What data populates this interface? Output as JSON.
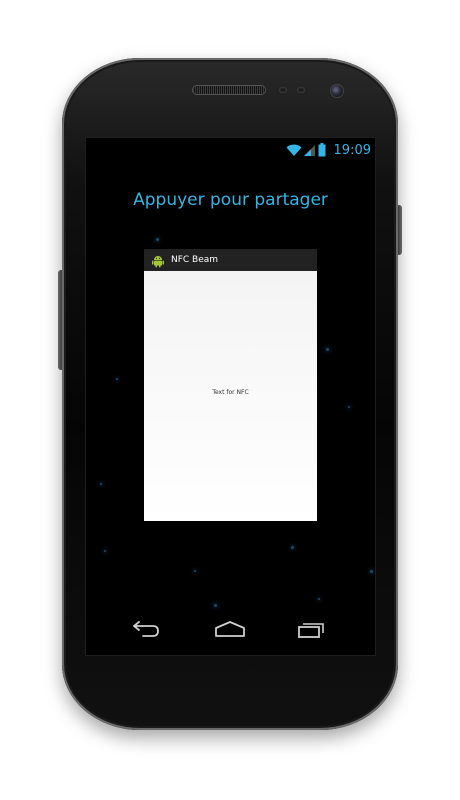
{
  "status_bar": {
    "time": "19:09",
    "icons": [
      "wifi-icon",
      "signal-icon",
      "battery-icon"
    ]
  },
  "share_prompt": "Appuyer pour partager",
  "app_preview": {
    "app_name": "NFC Beam",
    "body_text": "Text for NFC",
    "icon": "android-icon"
  },
  "nav_bar": {
    "icons": [
      "back-icon",
      "home-icon",
      "recent-apps-icon"
    ]
  },
  "colors": {
    "accent": "#33b5e5",
    "screen_background": "#000000",
    "app_titlebar": "#222222"
  }
}
